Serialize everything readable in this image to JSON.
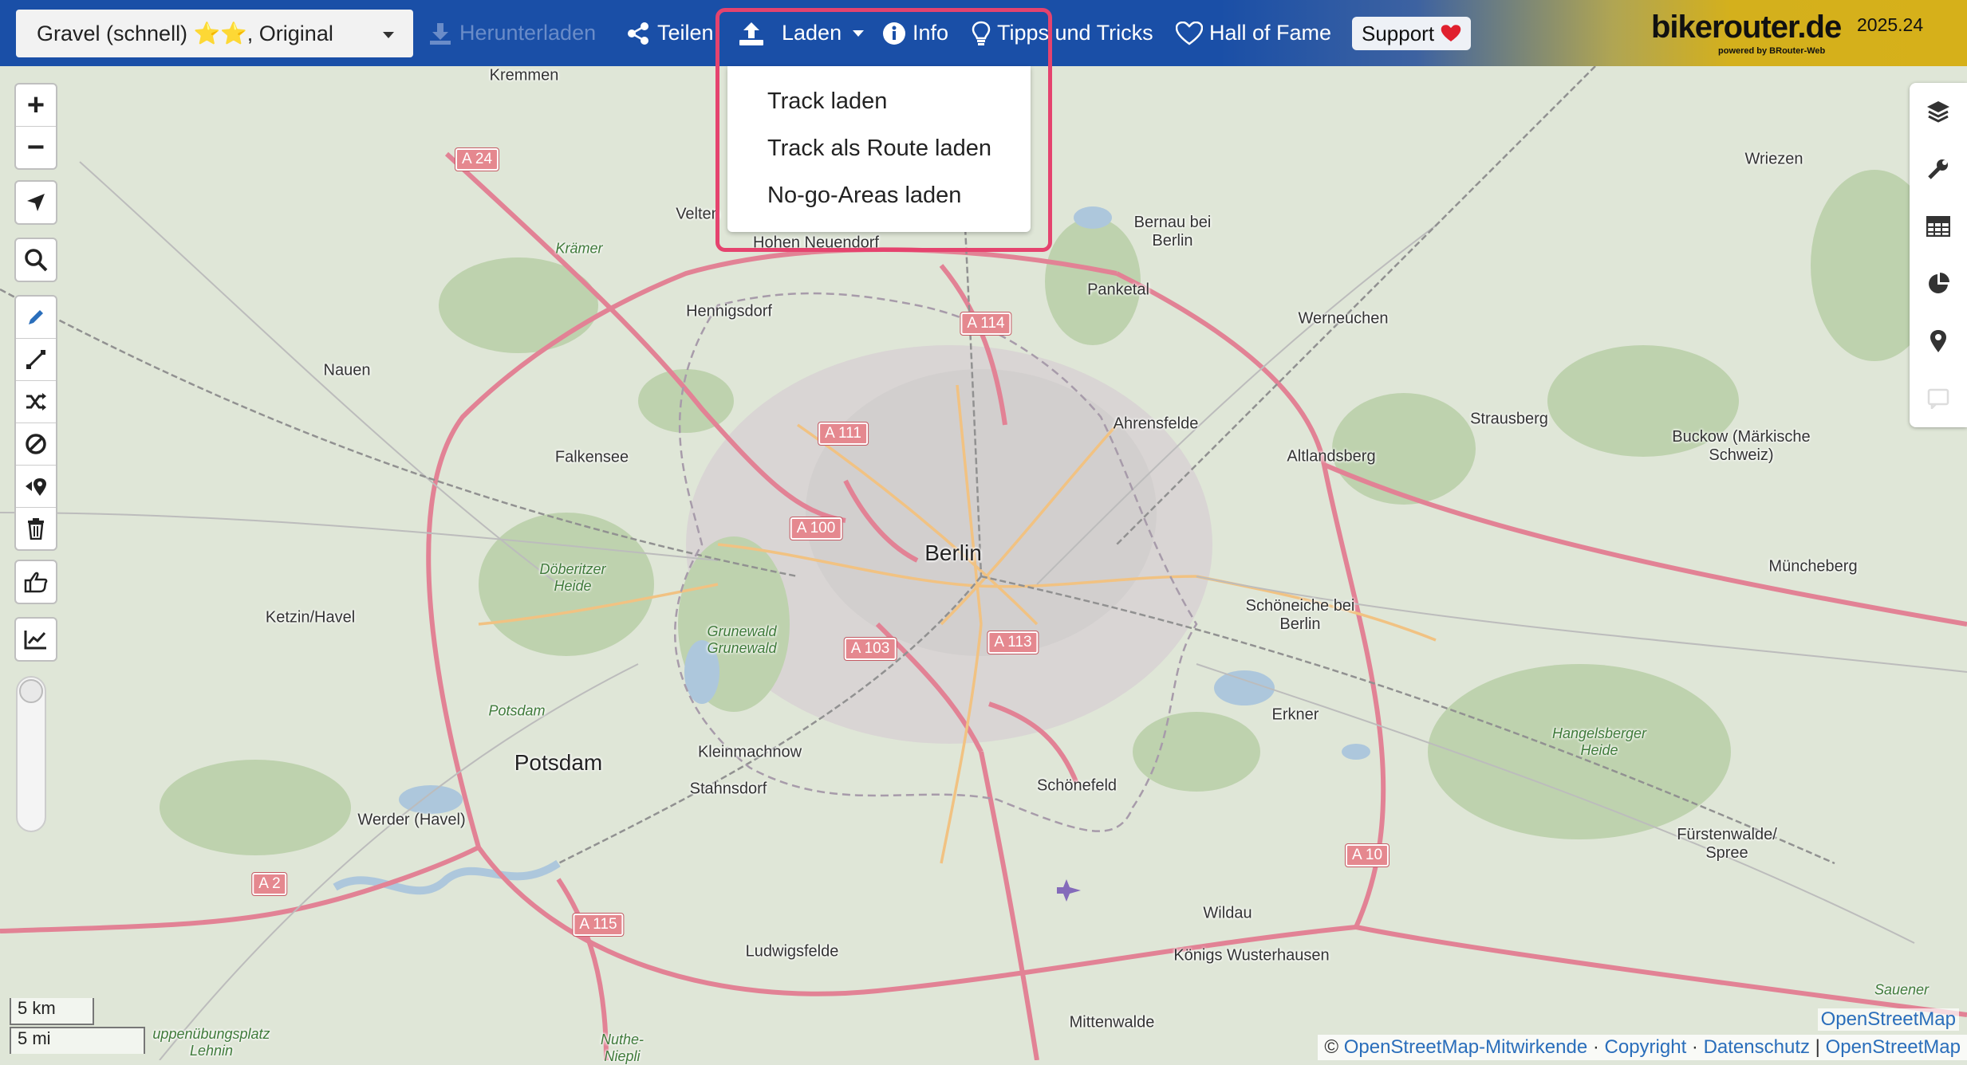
{
  "toolbar": {
    "profile": "Gravel (schnell) ⭐⭐, Original",
    "download": "Herunterladen",
    "share": "Teilen",
    "load": "Laden",
    "info": "Info",
    "tips": "Tipps und Tricks",
    "hall_of_fame": "Hall of Fame",
    "support": "Support",
    "brand": "bikerouter.de",
    "brand_sub": "powered by BRouter-Web",
    "version": "2025.24"
  },
  "load_menu": {
    "items": [
      "Track laden",
      "Track als Route laden",
      "No-go-Areas laden"
    ]
  },
  "map": {
    "places": {
      "kremmen": "Kremmen",
      "velten": "Velten",
      "hohen_neuendorf": "Hohen Neuendorf",
      "bernau": "Bernau bei Berlin",
      "wriezen": "Wriezen",
      "kramer": "Krämer",
      "panketal": "Panketal",
      "werneuchen": "Werneuchen",
      "hennigsdorf": "Hennigsdorf",
      "nauen": "Nauen",
      "strausberg": "Strausberg",
      "ahrensfelde": "Ahrensfelde",
      "altlandsberg": "Altlandsberg",
      "buckow": "Buckow (Märkische Schweiz)",
      "falkensee": "Falkensee",
      "berlin": "Berlin",
      "doeberitzer": "Döberitzer Heide",
      "ketzin": "Ketzin/Havel",
      "muencheberg": "Müncheberg",
      "schoeneiche": "Schöneiche bei Berlin",
      "grunewald": "Grunewald Grunewald",
      "erkner": "Erkner",
      "hangelsberger": "Hangelsberger Heide",
      "potsdam_forest": "Potsdam",
      "kleinmachnow": "Kleinmachnow",
      "potsdam": "Potsdam",
      "stahnsdorf": "Stahnsdorf",
      "schoenefeld": "Schönefeld",
      "werder": "Werder (Havel)",
      "fuerstenwalde": "Fürstenwalde/ Spree",
      "wildau": "Wildau",
      "ludwigsfelde": "Ludwigsfelde",
      "koenigs": "Königs Wusterhausen",
      "sauener": "Sauener",
      "mittenwalde": "Mittenwalde",
      "uebungsplatz": "uppenübungsplatz Lehnin",
      "nuthe": "Nuthe- Niepli"
    },
    "highways": {
      "a24": "A 24",
      "a114": "A 114",
      "a111": "A 111",
      "a100": "A 100",
      "a103": "A 103",
      "a113": "A 113",
      "a2": "A 2",
      "a115": "A 115",
      "a10": "A 10"
    },
    "scale_km": "5 km",
    "scale_mi": "5 mi"
  },
  "attribution": {
    "osm_tag": "OpenStreetMap",
    "copyright_symbol": "©",
    "contributors": "OpenStreetMap-Mitwirkende",
    "sep": "·",
    "copyright": "Copyright",
    "privacy": "Datenschutz",
    "pipe": "|",
    "osm": "OpenStreetMap"
  }
}
